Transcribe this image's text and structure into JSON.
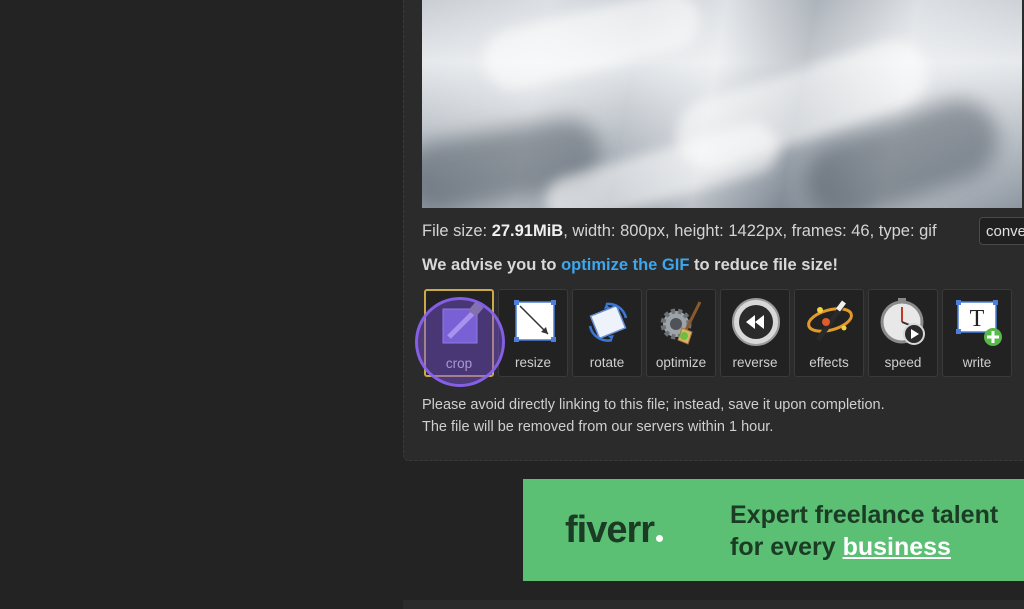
{
  "file_info": {
    "size_label": "File size: ",
    "size_value": "27.91MiB",
    "rest": ", width: 800px, height: 1422px, frames: 46, type: gif",
    "convert": "conve"
  },
  "advise": {
    "prefix": "We advise you to ",
    "link": "optimize the GIF",
    "suffix": " to reduce file size!"
  },
  "tools": [
    {
      "label": "crop",
      "icon": "crop-icon"
    },
    {
      "label": "resize",
      "icon": "resize-icon"
    },
    {
      "label": "rotate",
      "icon": "rotate-icon"
    },
    {
      "label": "optimize",
      "icon": "optimize-icon"
    },
    {
      "label": "reverse",
      "icon": "reverse-icon"
    },
    {
      "label": "effects",
      "icon": "effects-icon"
    },
    {
      "label": "speed",
      "icon": "speed-icon"
    },
    {
      "label": "write",
      "icon": "write-icon"
    }
  ],
  "notes": {
    "line1": "Please avoid directly linking to this file; instead, save it upon completion.",
    "line2": "The file will be removed from our servers within 1 hour."
  },
  "ad": {
    "logo": "fiverr",
    "line1": "Expert freelance talent",
    "line2_prefix": "for every ",
    "line2_link": "business"
  },
  "colors": {
    "link": "#3ea6ec",
    "ad_bg": "#5bbf74",
    "highlight": "#7c55e0"
  }
}
